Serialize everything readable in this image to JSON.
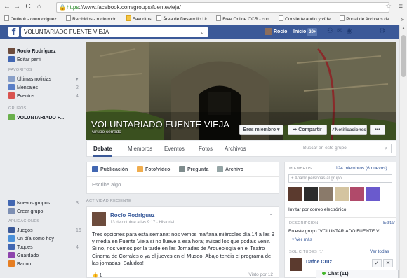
{
  "browser": {
    "url_scheme": "https",
    "url_rest": "://www.facebook.com/groups/fuentevieja/",
    "bookmarks": [
      {
        "label": "Outlook - conrodriguez..."
      },
      {
        "label": "Recibidos - rocio.rodri..."
      },
      {
        "label": "Favoritos"
      },
      {
        "label": "Área de Desarrollo Ur..."
      },
      {
        "label": "Free Online OCR - con..."
      },
      {
        "label": "Convierte audio y víde..."
      },
      {
        "label": "Portal de Archivos de..."
      }
    ],
    "more": "»"
  },
  "topbar": {
    "search_value": "VOLUNTARIADO FUENTE VIEJA",
    "user_name": "Rocío",
    "home_label": "Inicio",
    "home_badge": "20+"
  },
  "sidebar": {
    "profile_name": "Rocío Rodríguez",
    "edit_profile": "Editar perfil",
    "favorites_header": "FAVORITOS",
    "favorites": [
      {
        "label": "Últimas noticias",
        "count": "▾"
      },
      {
        "label": "Mensajes",
        "count": "2"
      },
      {
        "label": "Eventos",
        "count": "4"
      }
    ],
    "groups_header": "GRUPOS",
    "groups": [
      {
        "label": "VOLUNTARIADO F..."
      }
    ],
    "lower": [
      {
        "label": "Nuevos grupos",
        "count": "3"
      },
      {
        "label": "Crear grupo",
        "count": ""
      }
    ],
    "apps_header": "APLICACIONES",
    "apps": [
      {
        "label": "Juegos",
        "count": "16"
      },
      {
        "label": "Un día como hoy",
        "count": ""
      },
      {
        "label": "Toques",
        "count": "4"
      },
      {
        "label": "Guardado",
        "count": ""
      },
      {
        "label": "Badoo",
        "count": ""
      }
    ]
  },
  "cover": {
    "title": "VOLUNTARIADO FUENTE VIEJA",
    "subtitle": "Grupo cerrado",
    "member_button": "Eres miembro ▾",
    "share_button": "Compartir",
    "notif_button": "Notificaciones",
    "more_button": "•••"
  },
  "tabs": {
    "items": [
      "Debate",
      "Miembros",
      "Eventos",
      "Fotos",
      "Archivos"
    ],
    "search_placeholder": "Buscar en este grupo"
  },
  "composer": {
    "tabs": [
      "Publicación",
      "Foto/vídeo",
      "Pregunta",
      "Archivo"
    ],
    "placeholder": "Escribe algo..."
  },
  "activity_header": "ACTIVIDAD RECIENTE",
  "post": {
    "author": "Rocío Rodríguez",
    "time": "13 de octubre a las 9:17 · Historial",
    "text": "Tres opciones para esta semana: nos vemos mañana miércoles día 14 a las 9 y media en Fuente Vieja si no llueve a esa hora; avisad los que podáis venir. Si no, nos vemos por la tarde en las Jornadas de Arqueología en el Teatro Cinema de Corrales o ya el jueves en el Museo. Abajo tenéis el programa de las jornadas. Saludos!",
    "like_count": "1",
    "seen": "Visto por 12"
  },
  "right": {
    "members_header": "MIEMBROS",
    "members_count": "124 miembros (6 nuevos)",
    "add_placeholder": "+ Añadir personas al grupo",
    "invite": "Invitar por correo electrónico",
    "desc_header": "DESCRIPCIÓN",
    "edit": "Editar",
    "desc_text": "En este grupo \"VOLUNTARIADO FUENTE VI...",
    "see_more": "▾ Ver más",
    "requests_header": "SOLICITUDES (1)",
    "see_all": "Ver todas",
    "request_name": "Dafne Cruz"
  },
  "chat": {
    "label": "Chat (11)"
  },
  "colors": {
    "fb_blue": "#3b5998",
    "link": "#365899"
  }
}
